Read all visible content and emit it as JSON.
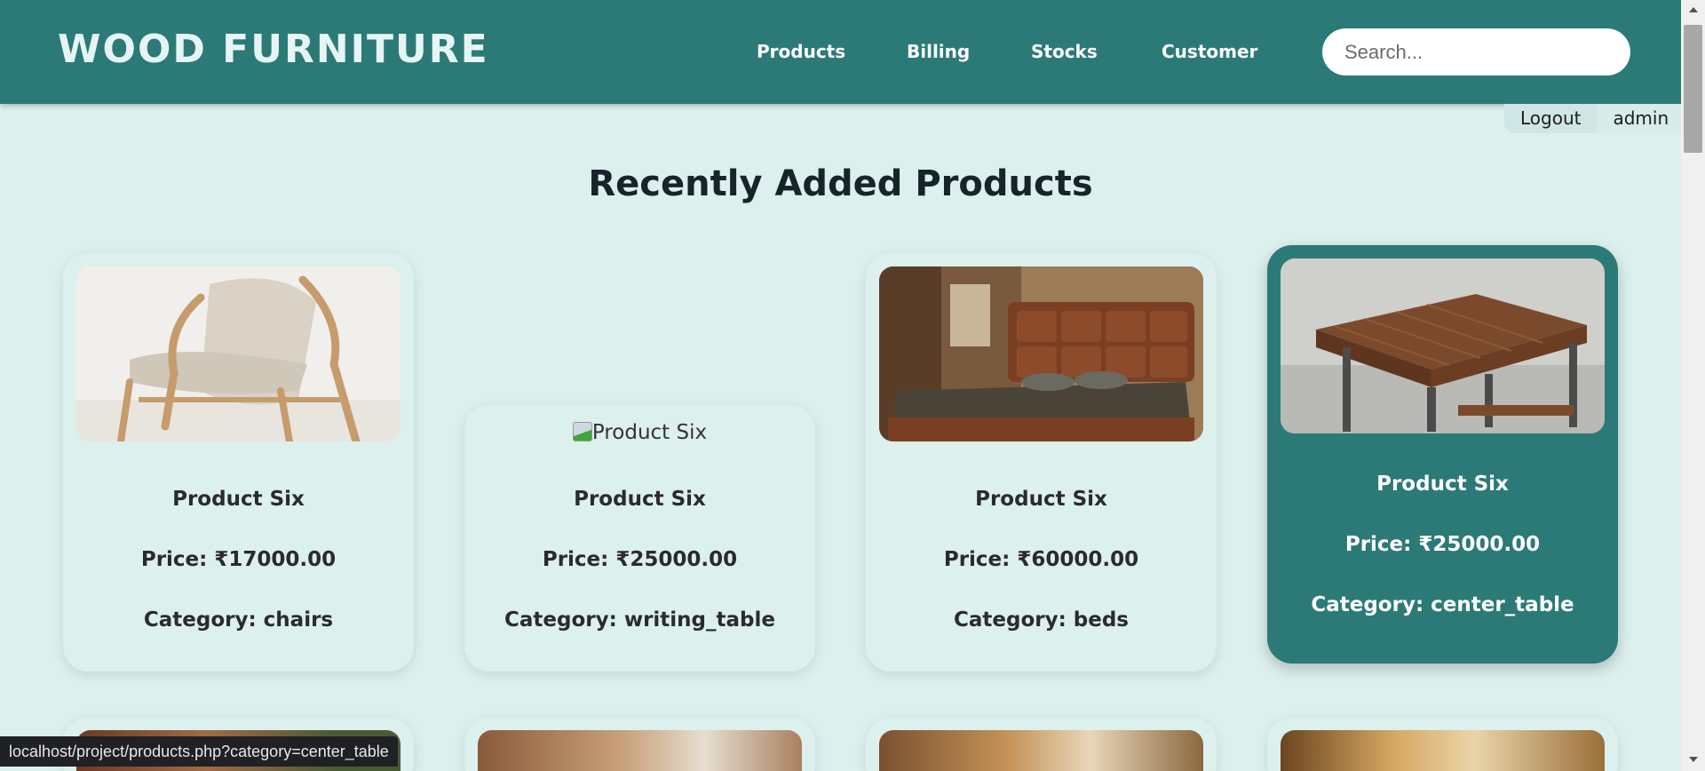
{
  "header": {
    "brand": "WOOD FURNITURE",
    "nav": [
      "Products",
      "Billing",
      "Stocks",
      "Customer"
    ],
    "search_placeholder": "Search..."
  },
  "user_bar": {
    "logout": "Logout",
    "username": "admin"
  },
  "main": {
    "title": "Recently Added Products",
    "products": [
      {
        "name": "Product Six",
        "price": "Price: ₹17000.00",
        "category": "Category: chairs",
        "image": "chair"
      },
      {
        "name": "Product Six",
        "price": "Price: ₹25000.00",
        "category": "Category: writing_table",
        "image": "broken",
        "alt": "Product Six"
      },
      {
        "name": "Product Six",
        "price": "Price: ₹60000.00",
        "category": "Category: beds",
        "image": "bed"
      },
      {
        "name": "Product Six",
        "price": "Price: ₹25000.00",
        "category": "Category: center_table",
        "image": "table",
        "hovered": true
      }
    ]
  },
  "status_bar": {
    "url": "localhost/project/products.php?category=center_table"
  },
  "colors": {
    "header_bg": "#2c7a77",
    "page_bg": "#dcf0ee",
    "card_hover_bg": "#2c7a77",
    "status_bar_bg": "#202124"
  }
}
